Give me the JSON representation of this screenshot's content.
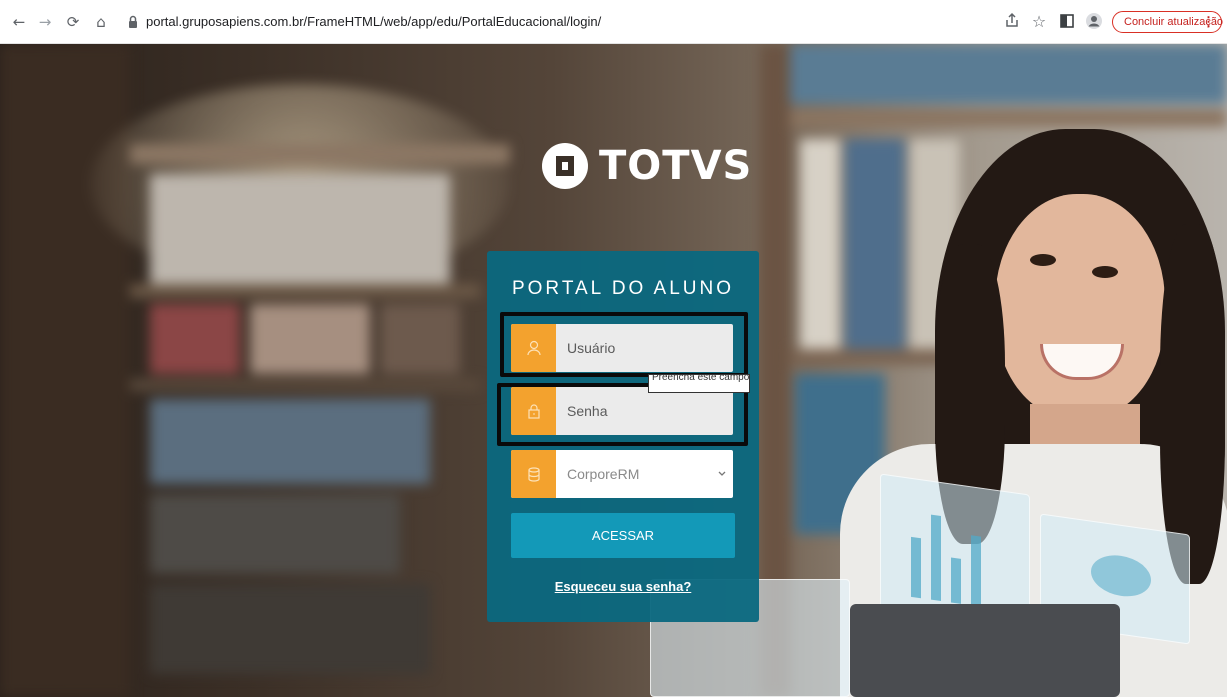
{
  "browser": {
    "url": "portal.gruposapiens.com.br/FrameHTML/web/app/edu/PortalEducacional/login/",
    "update_button": "Concluir atualização"
  },
  "logo": {
    "text": "TOTVS"
  },
  "login": {
    "title": "PORTAL DO ALUNO",
    "username_placeholder": "Usuário",
    "password_placeholder": "Senha",
    "alias_selected": "CorporeRM",
    "tooltip": "Preencha este campo.",
    "submit_label": "ACESSAR",
    "forgot_link": "Esqueceu sua senha?"
  },
  "colors": {
    "panel": "#0a6880",
    "icon_accent": "#f3a22e",
    "button": "#1399b8",
    "update_button_border": "#d93025"
  },
  "icons": [
    "back-arrow-icon",
    "forward-arrow-icon",
    "reload-icon",
    "home-icon",
    "lock-icon",
    "share-icon",
    "star-icon",
    "sidepanel-icon",
    "profile-icon",
    "user-icon",
    "padlock-icon",
    "database-icon",
    "chevron-down-icon"
  ]
}
